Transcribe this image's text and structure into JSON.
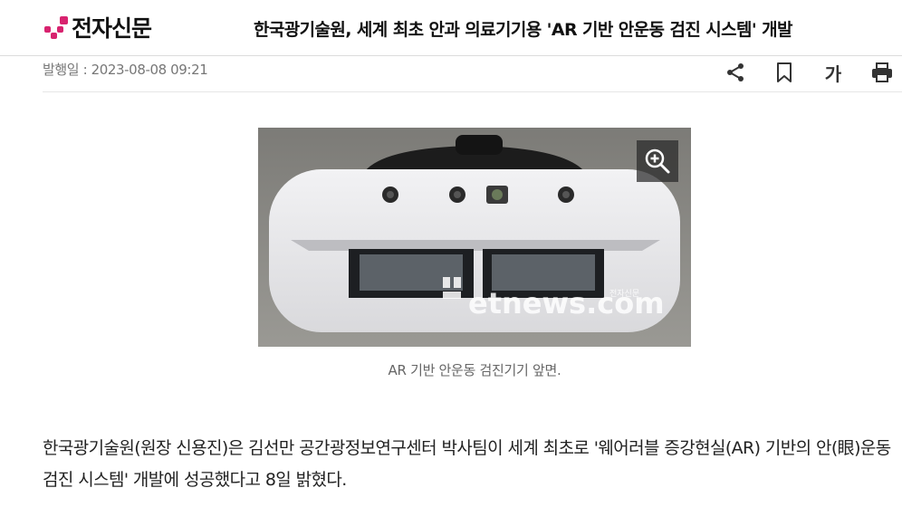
{
  "header": {
    "logo_text": "전자신문",
    "brand_color": "#d8236f",
    "headline": "한국광기술원, 세계 최초 안과 의료기기용 'AR 기반 안운동 검진 시스템' 개발"
  },
  "meta": {
    "published": "발행일 : 2023-08-08 09:21",
    "tools": [
      "share-icon",
      "bookmark-icon",
      "font-size-icon",
      "print-icon"
    ],
    "font_size_label": "가"
  },
  "figure": {
    "watermark": "etnews.com",
    "watermark_sub": "전자신문",
    "zoom_icon": "zoom-in-icon",
    "caption": "AR 기반 안운동 검진기기 앞면."
  },
  "article": {
    "paragraph": "한국광기술원(원장 신용진)은 김선만 공간광정보연구센터 박사팀이 세계 최초로 '웨어러블 증강현실(AR) 기반의 안(眼)운동 검진 시스템' 개발에 성공했다고 8일 밝혔다."
  }
}
